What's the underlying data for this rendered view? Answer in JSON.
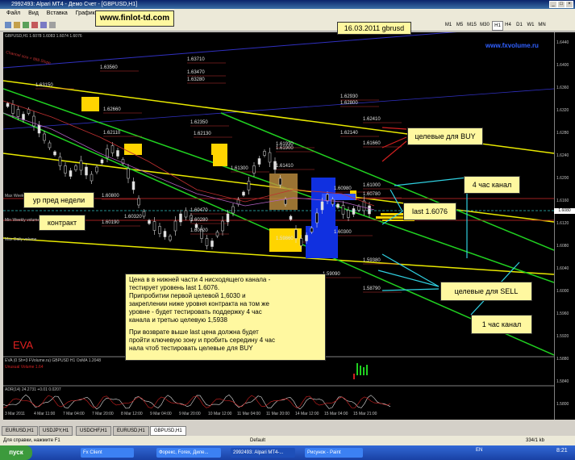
{
  "window": {
    "title": "2992493: Alpari MT4 - Демо Счет - [GBPUSD,H1]",
    "min": "_",
    "max": "□",
    "close": "×"
  },
  "menu": [
    "Файл",
    "Вид",
    "Вставка",
    "Графики"
  ],
  "timeframes": [
    "M1",
    "M5",
    "M15",
    "M30",
    "H1",
    "H4",
    "D1",
    "W1",
    "MN"
  ],
  "annotations": {
    "site_box": "www.finlot-td.com",
    "date_box": "16.03.2011 gbrusd",
    "watermark": "www.fxvolume.ru",
    "prev_week": "ур пред недели",
    "contract": "контракт",
    "buy_targets": "целевые для BUY",
    "four_hour_channel": "4 час канал",
    "last_box": "last 1.6076",
    "sell_targets": "целевые для SELL",
    "one_hour_channel": "1 час канал",
    "eva": "EVA",
    "main_text": [
      "Цена в в нижней части 4 нисходящего канала -",
      "тестирует уровень last 1.6076.",
      " Припробитии первой целевой 1,6030 и",
      "закреплении ниже уровня контракта на том же",
      "уровне - будет тестировать поддержку 4 час",
      "канала и третью целевую 1,5938",
      "",
      " При возврате выше last цена должна будет",
      "пройти ключевую зону и пробить середину 4 час",
      "нала чтоб тестировать целевые для BUY"
    ]
  },
  "chart_header": "GBPUSD,H1 1.6078 1.6083 1.6074 1.6076",
  "chart_labels": {
    "channel_left": "Channel size = 888 Slope",
    "max_weekly": "Max Weekly",
    "min_weekly": "Min Weekly volume",
    "max_daily": "Max Daily volume"
  },
  "levels": [
    "1.63560",
    "1.63710",
    "1.63470",
    "1.63280",
    "1.63150",
    "1.62660",
    "1.62350",
    "1.62930",
    "1.62800",
    "1.62410",
    "1.62110",
    "1.62130",
    "1.62140",
    "1.61930",
    "1.61900",
    "1.61660",
    "1.61300",
    "1.61410",
    "1.61000",
    "1.60980",
    "1.60800",
    "1.60780",
    "1.60470",
    "1.60320",
    "1.60190",
    "1.60280",
    "1.60020",
    "1.60300",
    "1.59860",
    "1.59380",
    "1.59090",
    "1.58790"
  ],
  "price_axis": [
    "1.6440",
    "1.6400",
    "1.6360",
    "1.6320",
    "1.6280",
    "1.6240",
    "1.6200",
    "1.6160",
    "1.6120",
    "1.6080",
    "1.6040",
    "1.6000",
    "1.5960",
    "1.5920",
    "1.5880",
    "1.5840",
    "1.5800"
  ],
  "time_axis": [
    "3 Mar 2011",
    "4 Mar 11:00",
    "7 Mar 04:00",
    "7 Mar 20:00",
    "8 Mar 12:00",
    "9 Mar 04:00",
    "9 Mar 20:00",
    "10 Mar 12:00",
    "11 Mar 04:00",
    "11 Mar 20:00",
    "14 Mar 12:00",
    "15 Mar 04:00",
    "15 Mar 21:00"
  ],
  "indicators": {
    "eva_header": "EVA (0 Sh=3 FVolume.ru) GBPUSD H1 OsMA 1.2048",
    "eva_sub": "Unusual Volume 1.64",
    "adr": "ADR(14) 24.2731 +0.01 0.0207"
  },
  "tabs": [
    "EURUSD,H1",
    "USDJPY,H1",
    "USDCHF,H1",
    "EURUSD,H1",
    "GBPUSD,H1"
  ],
  "status": {
    "help": "Для справки, нажмите F1",
    "profile": "Default",
    "conn": "334/1 kb"
  },
  "taskbar": {
    "start": "пуск",
    "items": [
      "Fx Client",
      "Форекс, Forex, Диле...",
      "2992493: Alpari MT4-...",
      "Рисунок - Paint"
    ],
    "lang": "EN",
    "clock": "8:21"
  }
}
